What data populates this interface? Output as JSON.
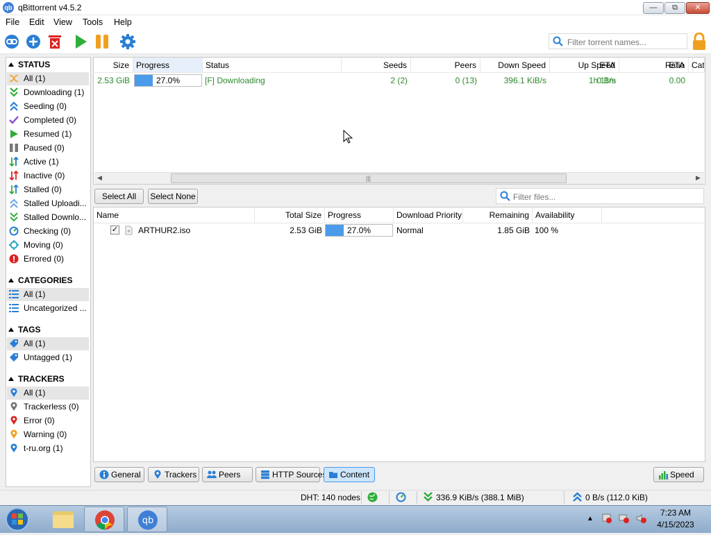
{
  "window": {
    "title": "qBittorrent v4.5.2",
    "app_icon": "qb"
  },
  "menu": [
    "File",
    "Edit",
    "View",
    "Tools",
    "Help"
  ],
  "toolbar": {
    "icons": [
      "add-link-icon",
      "add-torrent-icon",
      "delete-icon",
      "resume-icon",
      "pause-icon",
      "options-gear-icon",
      "lock-icon"
    ],
    "filter_placeholder": "Filter torrent names..."
  },
  "sidebar": {
    "status_header": "STATUS",
    "status_items": [
      {
        "label": "All (1)",
        "icon": "shuffle-icon"
      },
      {
        "label": "Downloading (1)",
        "icon": "download-icon"
      },
      {
        "label": "Seeding (0)",
        "icon": "upload-icon"
      },
      {
        "label": "Completed (0)",
        "icon": "checkmark-icon"
      },
      {
        "label": "Resumed (1)",
        "icon": "play-icon"
      },
      {
        "label": "Paused (0)",
        "icon": "pause-icon"
      },
      {
        "label": "Active (1)",
        "icon": "active-icon"
      },
      {
        "label": "Inactive (0)",
        "icon": "inactive-icon"
      },
      {
        "label": "Stalled (0)",
        "icon": "stalled-icon"
      },
      {
        "label": "Stalled Uploadi...",
        "icon": "stalled-upload-icon"
      },
      {
        "label": "Stalled Downlo...",
        "icon": "stalled-download-icon"
      },
      {
        "label": "Checking (0)",
        "icon": "checking-icon"
      },
      {
        "label": "Moving (0)",
        "icon": "moving-icon"
      },
      {
        "label": "Errored (0)",
        "icon": "error-icon"
      }
    ],
    "categories_header": "CATEGORIES",
    "category_items": [
      {
        "label": "All (1)",
        "icon": "list-icon"
      },
      {
        "label": "Uncategorized ...",
        "icon": "list-icon"
      }
    ],
    "tags_header": "TAGS",
    "tag_items": [
      {
        "label": "All (1)",
        "icon": "tag-icon"
      },
      {
        "label": "Untagged (1)",
        "icon": "tag-icon"
      }
    ],
    "trackers_header": "TRACKERS",
    "tracker_items": [
      {
        "label": "All (1)",
        "icon": "pin-icon"
      },
      {
        "label": "Trackerless (0)",
        "icon": "pin-icon"
      },
      {
        "label": "Error (0)",
        "icon": "pin-icon"
      },
      {
        "label": "Warning (0)",
        "icon": "pin-icon"
      },
      {
        "label": "t-ru.org (1)",
        "icon": "pin-icon"
      }
    ]
  },
  "torrents": {
    "columns": [
      "Size",
      "Progress",
      "Status",
      "Seeds",
      "Peers",
      "Down Speed",
      "Up Speed",
      "ETA",
      "Ratio",
      "Cat"
    ],
    "rows": [
      {
        "size": "2.53 GiB",
        "progress": 0.27,
        "progress_text": "27.0%",
        "status": "[F] Downloading",
        "seeds": "2 (2)",
        "peers": "0 (13)",
        "down_speed": "396.1 KiB/s",
        "up_speed": "0 B/s",
        "eta": "1h 11m",
        "ratio": "0.00"
      }
    ]
  },
  "content": {
    "select_all": "Select All",
    "select_none": "Select None",
    "filter_placeholder": "Filter files...",
    "columns": [
      "Name",
      "Total Size",
      "Progress",
      "Download Priority",
      "Remaining",
      "Availability"
    ],
    "rows": [
      {
        "name": "ARTHUR2.iso",
        "checked": true,
        "total_size": "2.53 GiB",
        "progress": 0.27,
        "progress_text": "27.0%",
        "priority": "Normal",
        "remaining": "1.85 GiB",
        "availability": "100 %"
      }
    ]
  },
  "tabs": [
    {
      "label": "General",
      "icon": "info-icon"
    },
    {
      "label": "Trackers",
      "icon": "pin-icon"
    },
    {
      "label": "Peers",
      "icon": "peers-icon"
    },
    {
      "label": "HTTP Sources",
      "icon": "server-icon"
    },
    {
      "label": "Content",
      "icon": "folder-icon",
      "active": true
    }
  ],
  "speed_button": "Speed",
  "statusbar": {
    "dht": "DHT: 140 nodes",
    "download": "336.9 KiB/s (388.1 MiB)",
    "upload": "0 B/s (112.0 KiB)"
  },
  "taskbar": {
    "time": "7:23 AM",
    "date": "4/15/2023",
    "apps": [
      "start-orb-icon",
      "file-explorer-icon",
      "chrome-icon",
      "qbittorrent-icon"
    ]
  },
  "colors": {
    "accent": "#4a9bea",
    "downloading_text": "#2d8a2d",
    "selected_bg": "#e5e5e5"
  }
}
